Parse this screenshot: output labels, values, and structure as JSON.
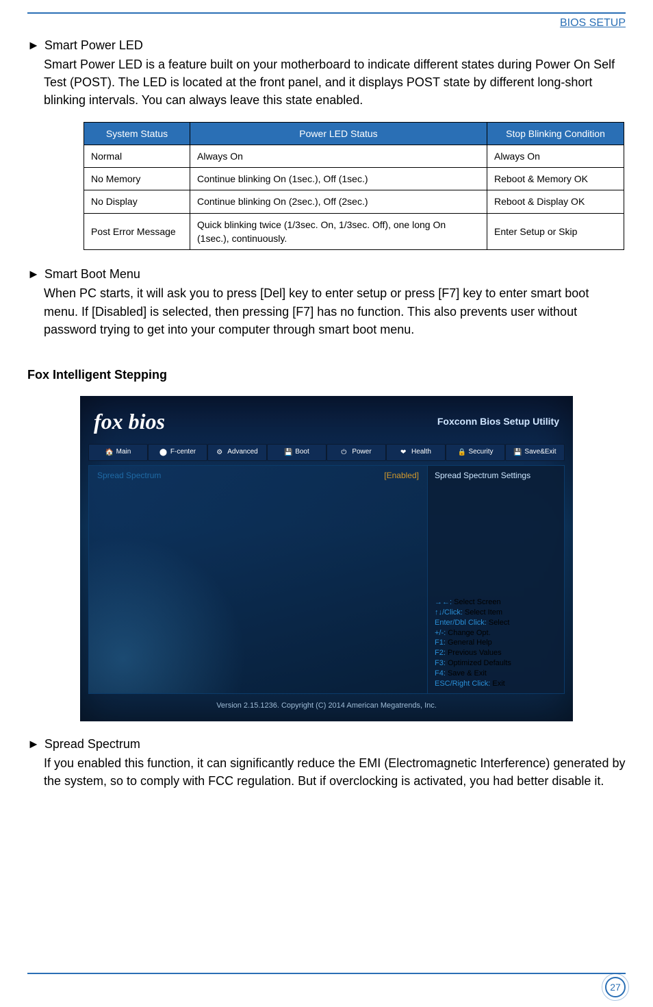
{
  "header": {
    "section": "BIOS SETUP"
  },
  "smart_power_led": {
    "title": "Smart Power LED",
    "arrow": "►",
    "desc": "Smart Power LED is a feature built on your motherboard to indicate different states during Power On Self Test (POST). The LED is located at the front panel, and it displays POST state by different long-short blinking intervals. You can always leave this state enabled."
  },
  "table": {
    "headers": [
      "System Status",
      "Power LED Status",
      "Stop Blinking Condition"
    ],
    "rows": [
      [
        "Normal",
        "Always On",
        "Always On"
      ],
      [
        "No Memory",
        "Continue blinking On (1sec.), Off (1sec.)",
        "Reboot & Memory OK"
      ],
      [
        "No Display",
        "Continue blinking On (2sec.), Off (2sec.)",
        "Reboot & Display OK"
      ],
      [
        "Post Error Message",
        "Quick blinking twice (1/3sec. On, 1/3sec. Off), one long On (1sec.), continuously.",
        "Enter Setup or Skip"
      ]
    ]
  },
  "smart_boot_menu": {
    "title": "Smart Boot Menu",
    "arrow": "►",
    "desc": "When PC starts, it will ask you to press [Del] key to enter setup or press [F7] key to enter smart boot menu. If [Disabled] is selected, then pressing [F7] has no function. This also prevents user without password trying to get into your computer through smart boot menu."
  },
  "fis_heading": "Fox Intelligent Stepping",
  "bios": {
    "logo": "fox bios",
    "title": "Foxconn Bios Setup Utility",
    "tabs": [
      "Main",
      "F-center",
      "Advanced",
      "Boot",
      "Power",
      "Health",
      "Security",
      "Save&Exit"
    ],
    "spread_label": "Spread Spectrum",
    "spread_value": "[Enabled]",
    "side_top": "Spread Spectrum Settings",
    "keys": [
      {
        "k": "→←:",
        "t": " Select Screen"
      },
      {
        "k": "↑↓/Click:",
        "t": " Select Item"
      },
      {
        "k": "Enter/Dbl Click:",
        "t": " Select"
      },
      {
        "k": "+/-:",
        "t": " Change Opt."
      },
      {
        "k": "F1:",
        "t": " General Help"
      },
      {
        "k": "F2:",
        "t": " Previous Values"
      },
      {
        "k": "F3:",
        "t": " Optimized Defaults"
      },
      {
        "k": "F4:",
        "t": " Save & Exit"
      },
      {
        "k": "ESC/Right Click:",
        "t": " Exit"
      }
    ],
    "footer": "Version 2.15.1236. Copyright (C) 2014 American Megatrends, Inc."
  },
  "spread_spectrum": {
    "title": "Spread Spectrum",
    "arrow": "►",
    "desc": "If you enabled this function, it can significantly reduce the EMI (Electromagnetic Interference) generated by the system, so to comply with FCC regulation. But if overclocking is activated, you had better disable it."
  },
  "page_number": "27"
}
